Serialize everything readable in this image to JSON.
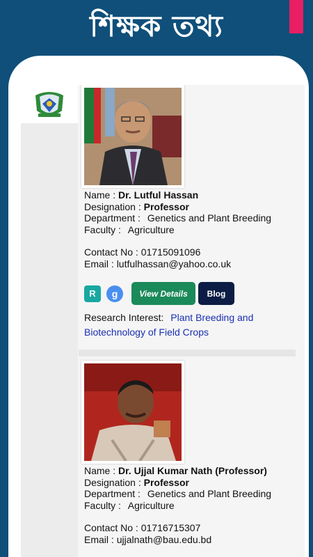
{
  "promo": {
    "title": "শিক্ষক তথ্য"
  },
  "colors": {
    "background": "#0f4f7a",
    "accent": "#e91e63",
    "view_details": "#1b8a5a",
    "blog": "#0c1c44",
    "link": "#1a2fb0"
  },
  "header": {
    "logo_icon": "university-crest-icon",
    "menu_icon": "hamburger-menu-icon"
  },
  "teachers": [
    {
      "name_label": "Name :",
      "name": "Dr. Lutful Hassan",
      "designation_label": "Designation :",
      "designation": "Professor",
      "department_label": "Department :",
      "department": "Genetics and Plant Breeding",
      "faculty_label": "Faculty :",
      "faculty": "Agriculture",
      "contact_label": "Contact No :",
      "contact": "01715091096",
      "email_label": "Email :",
      "email": "lutfulhassan@yahoo.co.uk",
      "researchgate_glyph": "R",
      "scholar_glyph": "g",
      "view_details_label": "View Details",
      "blog_label": "Blog",
      "research_label": "Research Interest:",
      "research_interest": "Plant Breeding and Biotechnology of Field Crops"
    },
    {
      "name_label": "Name :",
      "name": "Dr. Ujjal Kumar Nath (Professor)",
      "designation_label": "Designation :",
      "designation": "Professor",
      "department_label": "Department :",
      "department": "Genetics and Plant Breeding",
      "faculty_label": "Faculty :",
      "faculty": "Agriculture",
      "contact_label": "Contact No :",
      "contact": "01716715307",
      "email_label": "Email :",
      "email": "ujjalnath@bau.edu.bd"
    }
  ]
}
